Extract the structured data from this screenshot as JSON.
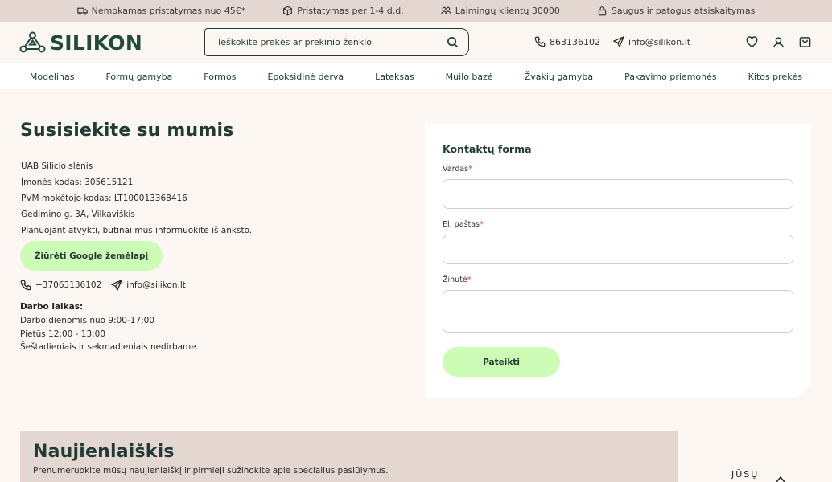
{
  "topbar": {
    "items": [
      {
        "icon": "truck-icon",
        "text": "Nemokamas pristatymas nuo 45€*"
      },
      {
        "icon": "box-icon",
        "text": "Pristatymas per 1-4 d.d."
      },
      {
        "icon": "people-icon",
        "text": "Laimingų klientų 30000"
      },
      {
        "icon": "lock-icon",
        "text": "Saugus ir patogus atsiskaitymas"
      }
    ]
  },
  "header": {
    "logo_text": "SILIKON",
    "search_placeholder": "Ieškokite prekės ar prekinio ženklo",
    "phone": "863136102",
    "email": "info@silikon.lt"
  },
  "nav": {
    "items": [
      "Modelinas",
      "Formų gamyba",
      "Formos",
      "Epoksidinė derva",
      "Lateksas",
      "Muilo bazė",
      "Žvakių gamyba",
      "Pakavimo priemonės",
      "Kitos prekės"
    ]
  },
  "contact": {
    "title": "Susisiekite su mumis",
    "lines": [
      "UAB Silicio slėnis",
      "Įmonės kodas: 305615121",
      "PVM mokėtojo kodas: LT100013368416",
      "Gedimino g. 3A, Vilkaviškis",
      "Planuojant atvykti, būtinai mus informuokite iš anksto."
    ],
    "map_button": "Žiūrėti Google žemėlapį",
    "phone": "+37063136102",
    "email": "info@silikon.lt",
    "hours_title": "Darbo laikas:",
    "hours": [
      "Darbo dienomis nuo 9:00-17:00",
      "Pietūs 12:00 - 13:00",
      "Šeštadieniais ir sekmadieniais nedirbame."
    ]
  },
  "form": {
    "title": "Kontaktų forma",
    "name_label": "Vardas",
    "email_label": "El. paštas",
    "message_label": "Žinutė",
    "required_mark": "*",
    "submit": "Pateikti"
  },
  "newsletter": {
    "title": "Naujienlaiškis",
    "text": "Prenumeruokite mūsų naujienlaiškį ir pirmieji sužinokite apie specialius pasiūlymus."
  },
  "side_badge": "JŪSŲ",
  "colors": {
    "accent": "#cdfcb6",
    "brand": "#1f4a3c",
    "beige": "#e4d7d2",
    "bg": "#fcf7f2"
  }
}
